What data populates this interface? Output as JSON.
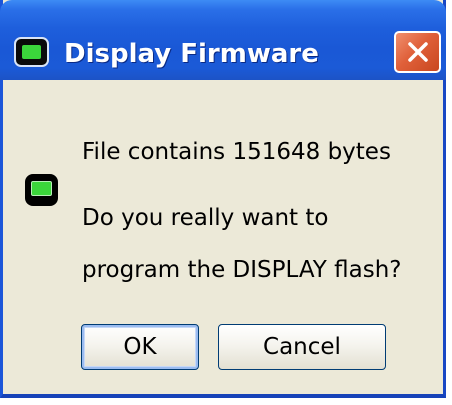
{
  "dialog": {
    "title": "Display Firmware",
    "title_icon": "display-device-icon",
    "close_icon": "close-icon",
    "message_icon": "display-device-icon",
    "message_line1": "File contains 151648 bytes",
    "message_line2": "Do you really want to",
    "message_line3": "program the DISPLAY flash?",
    "ok_label": "OK",
    "cancel_label": "Cancel"
  },
  "colors": {
    "titlebar_blue": "#1e5fdc",
    "window_face": "#ece9d8",
    "close_red": "#e0603a",
    "icon_screen_green": "#3bd63b"
  }
}
